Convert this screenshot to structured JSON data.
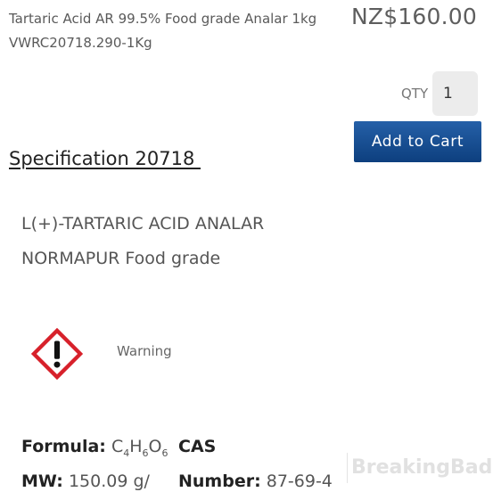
{
  "product": {
    "title_line1": "Tartaric Acid AR 99.5% Food grade Analar 1kg",
    "title_line2": "VWRC20718.290-1Kg",
    "price": "NZ$160.00"
  },
  "cart": {
    "qty_label": "QTY",
    "qty_value": "1",
    "add_to_cart_label": "Add to Cart",
    "button_color": "#1a4f94"
  },
  "specification": {
    "heading": "Specification 20718 ",
    "desc_line1": "L(+)-TARTARIC ACID ANALAR",
    "desc_line2": "NORMAPUR Food grade"
  },
  "hazard": {
    "icon": "ghs-exclamation-icon",
    "signal_word": "Warning",
    "pictogram_color": "#d7212b"
  },
  "facts": {
    "formula_label": "Formula:",
    "formula_parts": [
      "C",
      "4",
      "H",
      "6",
      "O",
      "6"
    ],
    "cas_label": "CAS",
    "mw_label": "MW:",
    "mw_value": "150.09 g/",
    "number_label": "Number:",
    "number_value": "87-69-4"
  },
  "watermark": {
    "text": "BreakingBad"
  }
}
